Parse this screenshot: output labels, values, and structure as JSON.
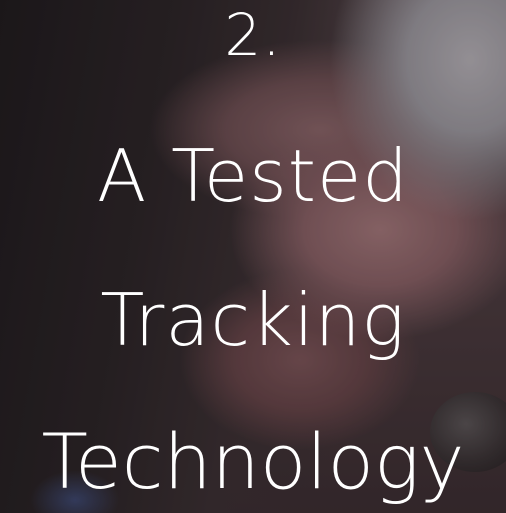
{
  "caption": {
    "number": "2.",
    "line1": "A Tested",
    "line2": "Tracking",
    "line3": "Technology"
  },
  "colors": {
    "text": "#ffffff",
    "background_dark": "#2a2224",
    "skin_tone": "#8a6165"
  }
}
